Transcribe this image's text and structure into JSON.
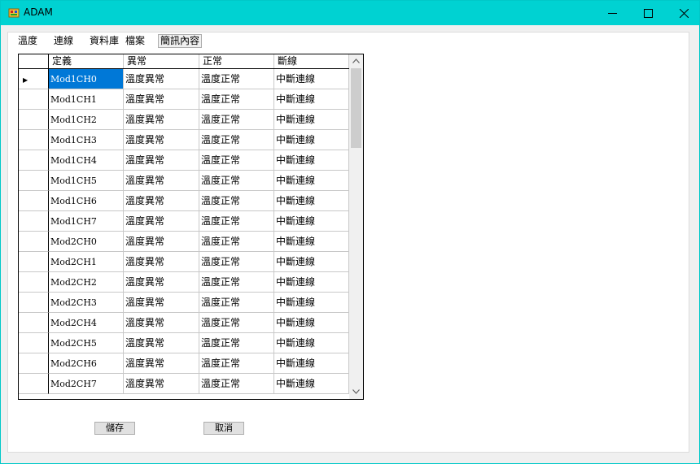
{
  "window": {
    "title": "ADAM"
  },
  "titlebar_buttons": {
    "minimize": "—",
    "maximize": "☐",
    "close": "✕"
  },
  "tabs": [
    {
      "label": "溫度"
    },
    {
      "label": "連線"
    },
    {
      "label": "資料庫"
    },
    {
      "label": "檔案"
    },
    {
      "label": "簡訊內容"
    }
  ],
  "active_tab": "簡訊內容",
  "grid": {
    "columns": [
      "定義",
      "異常",
      "正常",
      "斷線"
    ],
    "rows": [
      {
        "def": "Mod1CH0",
        "abnormal": "溫度異常",
        "normal": "溫度正常",
        "disconnect": "中斷連線"
      },
      {
        "def": "Mod1CH1",
        "abnormal": "溫度異常",
        "normal": "溫度正常",
        "disconnect": "中斷連線"
      },
      {
        "def": "Mod1CH2",
        "abnormal": "溫度異常",
        "normal": "溫度正常",
        "disconnect": "中斷連線"
      },
      {
        "def": "Mod1CH3",
        "abnormal": "溫度異常",
        "normal": "溫度正常",
        "disconnect": "中斷連線"
      },
      {
        "def": "Mod1CH4",
        "abnormal": "溫度異常",
        "normal": "溫度正常",
        "disconnect": "中斷連線"
      },
      {
        "def": "Mod1CH5",
        "abnormal": "溫度異常",
        "normal": "溫度正常",
        "disconnect": "中斷連線"
      },
      {
        "def": "Mod1CH6",
        "abnormal": "溫度異常",
        "normal": "溫度正常",
        "disconnect": "中斷連線"
      },
      {
        "def": "Mod1CH7",
        "abnormal": "溫度異常",
        "normal": "溫度正常",
        "disconnect": "中斷連線"
      },
      {
        "def": "Mod2CH0",
        "abnormal": "溫度異常",
        "normal": "溫度正常",
        "disconnect": "中斷連線"
      },
      {
        "def": "Mod2CH1",
        "abnormal": "溫度異常",
        "normal": "溫度正常",
        "disconnect": "中斷連線"
      },
      {
        "def": "Mod2CH2",
        "abnormal": "溫度異常",
        "normal": "溫度正常",
        "disconnect": "中斷連線"
      },
      {
        "def": "Mod2CH3",
        "abnormal": "溫度異常",
        "normal": "溫度正常",
        "disconnect": "中斷連線"
      },
      {
        "def": "Mod2CH4",
        "abnormal": "溫度異常",
        "normal": "溫度正常",
        "disconnect": "中斷連線"
      },
      {
        "def": "Mod2CH5",
        "abnormal": "溫度異常",
        "normal": "溫度正常",
        "disconnect": "中斷連線"
      },
      {
        "def": "Mod2CH6",
        "abnormal": "溫度異常",
        "normal": "溫度正常",
        "disconnect": "中斷連線"
      },
      {
        "def": "Mod2CH7",
        "abnormal": "溫度異常",
        "normal": "溫度正常",
        "disconnect": "中斷連線"
      }
    ],
    "selected_row": 0,
    "current_row_marker": "▶"
  },
  "buttons": {
    "save": "儲存",
    "cancel": "取消"
  },
  "colors": {
    "titlebar": "#00d2d2",
    "selection": "#0078d7"
  },
  "icons": {
    "app": "app-icon",
    "scroll_up": "chevron-up-icon",
    "scroll_down": "chevron-down-icon"
  }
}
